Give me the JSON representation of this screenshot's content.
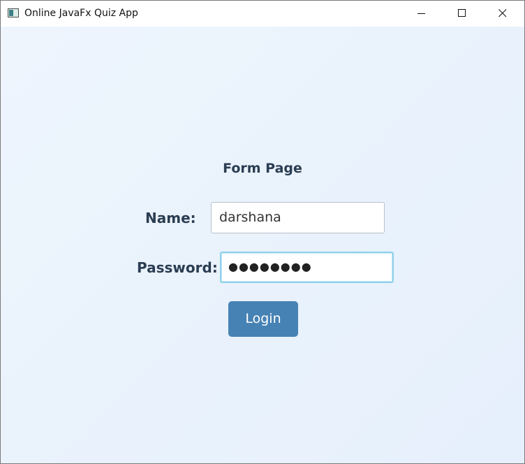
{
  "window": {
    "title": "Online JavaFx Quiz App",
    "icons": {
      "app": "app-icon",
      "minimize": "minimize-icon",
      "maximize": "maximize-icon",
      "close": "close-icon"
    }
  },
  "form": {
    "title": "Form Page",
    "name_label": "Name:",
    "name_value": "darshana",
    "password_label": "Password:",
    "password_masked": "●●●●●●●●",
    "login_label": "Login"
  },
  "colors": {
    "background": "#eaf3fc",
    "label_text": "#2b3d52",
    "button_bg": "#4682b4",
    "button_text": "#ffffff",
    "focus_border": "#8ed0ea"
  }
}
